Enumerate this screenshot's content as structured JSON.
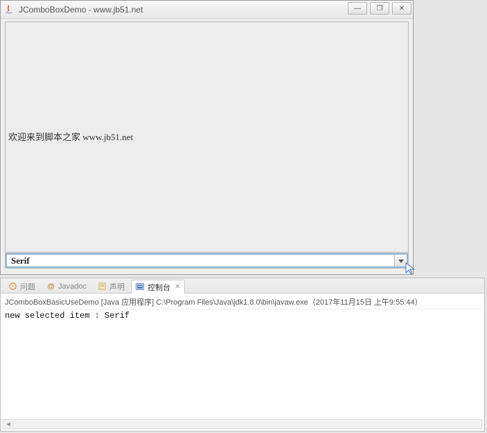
{
  "window": {
    "title": "JComboBoxDemo - www.jb51.net",
    "buttons": {
      "min": "—",
      "max": "❐",
      "close": "✕"
    }
  },
  "textarea": {
    "content": "欢迎来到脚本之家 www.jb51.net"
  },
  "combobox": {
    "selected": "Serif"
  },
  "tabs": {
    "problems": "问题",
    "javadoc": "Javadoc",
    "declaration": "声明",
    "console": "控制台"
  },
  "console": {
    "header": "JComboBoxBasicUseDemo [Java 应用程序] C:\\Program Files\\Java\\jdk1.8.0\\bin\\javaw.exe（2017年11月15日 上午9:55:44）",
    "output": "new selected item : Serif"
  },
  "icons": {
    "at": "@",
    "chevron_left": "◄"
  }
}
